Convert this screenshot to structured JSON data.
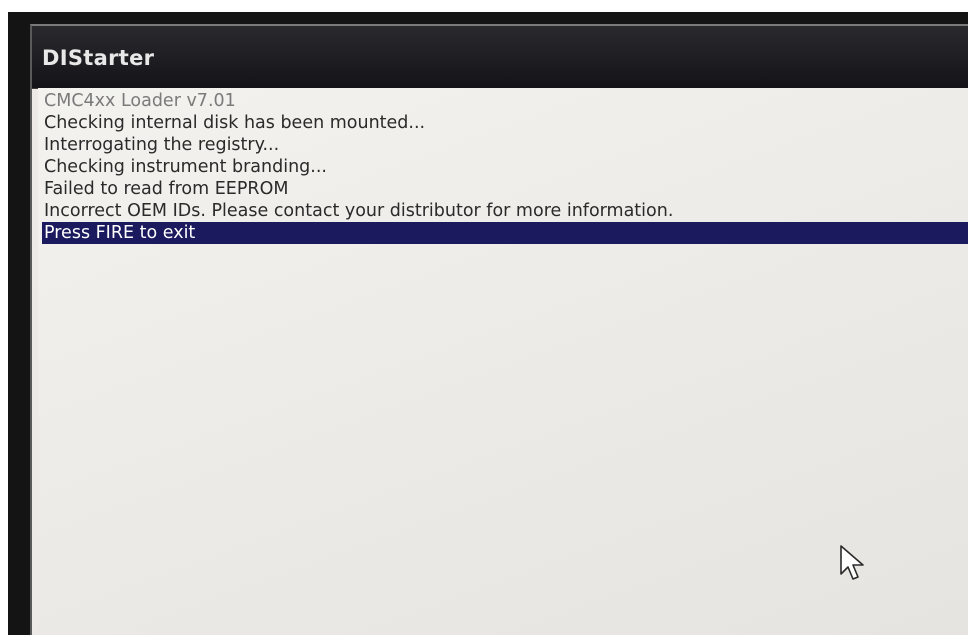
{
  "window": {
    "title": "DIStarter"
  },
  "log": {
    "lines": [
      "CMC4xx Loader v7.01",
      "Checking internal disk has been mounted...",
      "Interrogating the registry...",
      "Checking instrument branding...",
      "Failed to read from EEPROM",
      "Incorrect OEM IDs. Please contact your distributor for more information.",
      "Press FIRE to exit"
    ]
  },
  "cursor_icon": "mouse-pointer-arrow",
  "colors": {
    "title_bar": "#1b1b1f",
    "selection": "#1b1a5e",
    "background": "#ece9e6"
  }
}
